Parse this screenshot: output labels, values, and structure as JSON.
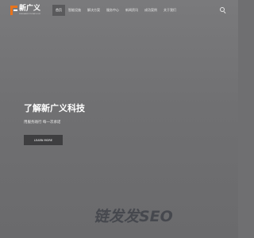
{
  "header": {
    "logo": {
      "name": "新广义",
      "sub": "XINGUANGYI TECHNOLOGY"
    },
    "nav": [
      {
        "label": "首页",
        "active": true
      },
      {
        "label": "智能设施",
        "active": false
      },
      {
        "label": "解决方案",
        "active": false
      },
      {
        "label": "服务中心",
        "active": false
      },
      {
        "label": "新闻资讯",
        "active": false
      },
      {
        "label": "成功案例",
        "active": false
      },
      {
        "label": "关于我们",
        "active": false
      }
    ],
    "search_icon": "search-icon"
  },
  "hero": {
    "title": "了解新广义科技",
    "subtitle": "用服务践行 每一次承诺",
    "button_label": "LEARN MORE"
  },
  "watermark": {
    "text": "链发发SEO"
  },
  "colors": {
    "brand_orange": "#e8731c",
    "hero_bg": "#707072",
    "button_bg": "#3e3e40"
  }
}
